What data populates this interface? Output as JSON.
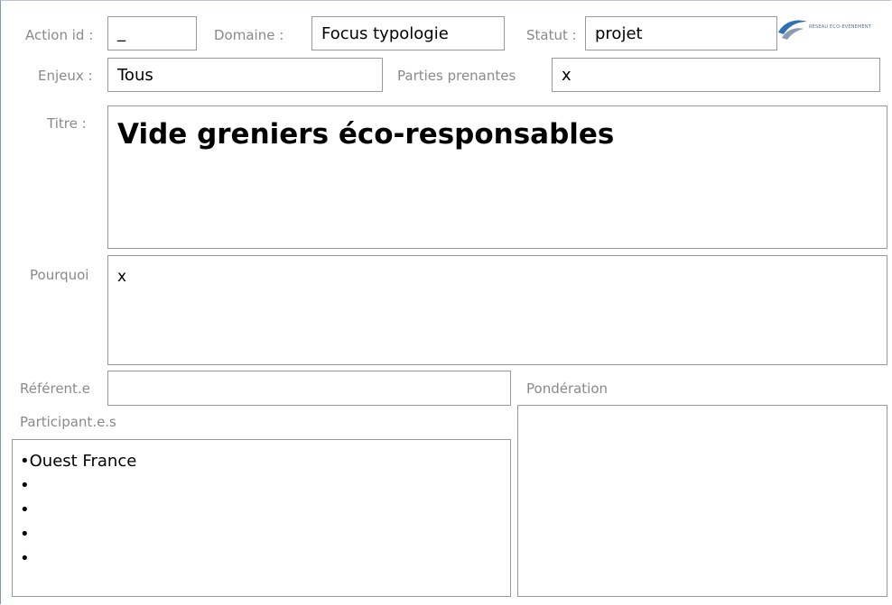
{
  "labels": {
    "action_id": "Action id :",
    "domaine": "Domaine :",
    "statut": "Statut :",
    "enjeux": "Enjeux :",
    "parties_prenantes": "Parties prenantes",
    "titre": "Titre :",
    "pourquoi": "Pourquoi",
    "referent": "Référent.e",
    "ponderation": "Pondération",
    "participants": "Participant.e.s"
  },
  "values": {
    "action_id": "_",
    "domaine": "Focus typologie",
    "statut": "projet",
    "enjeux": "Tous",
    "parties_prenantes": "x",
    "titre": "Vide greniers éco-responsables",
    "pourquoi": "x",
    "referent": "",
    "ponderation": ""
  },
  "participants": [
    "Ouest France",
    "",
    "",
    "",
    ""
  ],
  "logo": {
    "text": "RESEAU ECO-EVENEMENT",
    "colors": {
      "wave": "#2f6fb4",
      "leaf": "#8a9bb0"
    }
  }
}
